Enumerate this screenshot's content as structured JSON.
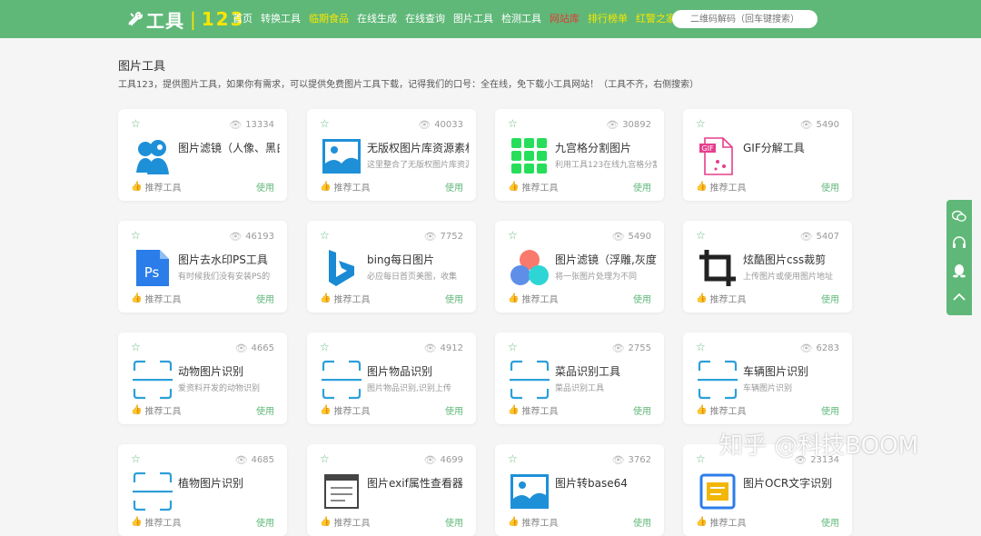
{
  "header": {
    "logo_main": "工具",
    "logo_sep": "|",
    "logo_num": "123",
    "nav": [
      {
        "label": "首页",
        "color": "white"
      },
      {
        "label": "转换工具",
        "color": "white"
      },
      {
        "label": "临期食品",
        "color": "yellow"
      },
      {
        "label": "在线生成",
        "color": "white"
      },
      {
        "label": "在线查询",
        "color": "white"
      },
      {
        "label": "图片工具",
        "color": "white"
      },
      {
        "label": "检测工具",
        "color": "white"
      },
      {
        "label": "网站库",
        "color": "red"
      },
      {
        "label": "排行榜单",
        "color": "yellow"
      },
      {
        "label": "红警之家",
        "color": "yellow"
      }
    ],
    "search_placeholder": "二维码解码（回车键搜索）"
  },
  "page": {
    "title": "图片工具",
    "desc": "工具123，提供图片工具，如果你有需求，可以提供免费图片工具下载，记得我们的口号：全在线，免下载小工具网站！（工具不齐，右侧搜索）"
  },
  "card_labels": {
    "recommend": "推荐工具",
    "use": "使用"
  },
  "cards": [
    {
      "name": "图片滤镜（人像、黑白",
      "sub": "",
      "views": "13334",
      "icon": "silhouette-icon"
    },
    {
      "name": "无版权图片库资源素材",
      "sub": "这里整合了无版权图片库资源",
      "views": "40033",
      "icon": "image-icon"
    },
    {
      "name": "九宫格分割图片",
      "sub": "利用工具123在线九宫格分割",
      "views": "30892",
      "icon": "nine-grid-icon"
    },
    {
      "name": "GIF分解工具",
      "sub": "",
      "views": "5490",
      "icon": "gif-file-icon"
    },
    {
      "name": "图片去水印PS工具",
      "sub": "有时候我们没有安装PS的",
      "views": "46193",
      "icon": "ps-icon"
    },
    {
      "name": "bing每日图片",
      "sub": "必应每日首页美图，收集",
      "views": "7752",
      "icon": "bing-icon"
    },
    {
      "name": "图片滤镜（浮雕,灰度",
      "sub": "将一张图片处理为不同",
      "views": "5490",
      "icon": "color-circles-icon"
    },
    {
      "name": "炫酷图片css裁剪",
      "sub": "上传图片或使用图片地址",
      "views": "5407",
      "icon": "crop-icon"
    },
    {
      "name": "动物图片识别",
      "sub": "爱资料开发的动物识别",
      "views": "4665",
      "icon": "scan-frame-icon"
    },
    {
      "name": "图片物品识别",
      "sub": "图片物品识别,识别上传",
      "views": "4912",
      "icon": "scan-frame-icon"
    },
    {
      "name": "菜品识别工具",
      "sub": "菜品识别工具",
      "views": "2755",
      "icon": "scan-frame-icon"
    },
    {
      "name": "车辆图片识别",
      "sub": "车辆图片识别",
      "views": "6283",
      "icon": "scan-frame-icon"
    },
    {
      "name": "植物图片识别",
      "sub": "",
      "views": "4685",
      "icon": "scan-frame-icon"
    },
    {
      "name": "图片exif属性查看器",
      "sub": "",
      "views": "4699",
      "icon": "document-icon"
    },
    {
      "name": "图片转base64",
      "sub": "",
      "views": "3762",
      "icon": "image-icon"
    },
    {
      "name": "图片OCR文字识别",
      "sub": "",
      "views": "23134",
      "icon": "ocr-icon"
    }
  ],
  "side_toolbar": [
    "wechat-icon",
    "headset-icon",
    "qq-icon",
    "up-arrow-icon"
  ],
  "watermark": "知乎 @科技BOOM",
  "colors": {
    "brand": "#5fb878",
    "highlight": "#f7e600",
    "alert": "#e53935"
  }
}
